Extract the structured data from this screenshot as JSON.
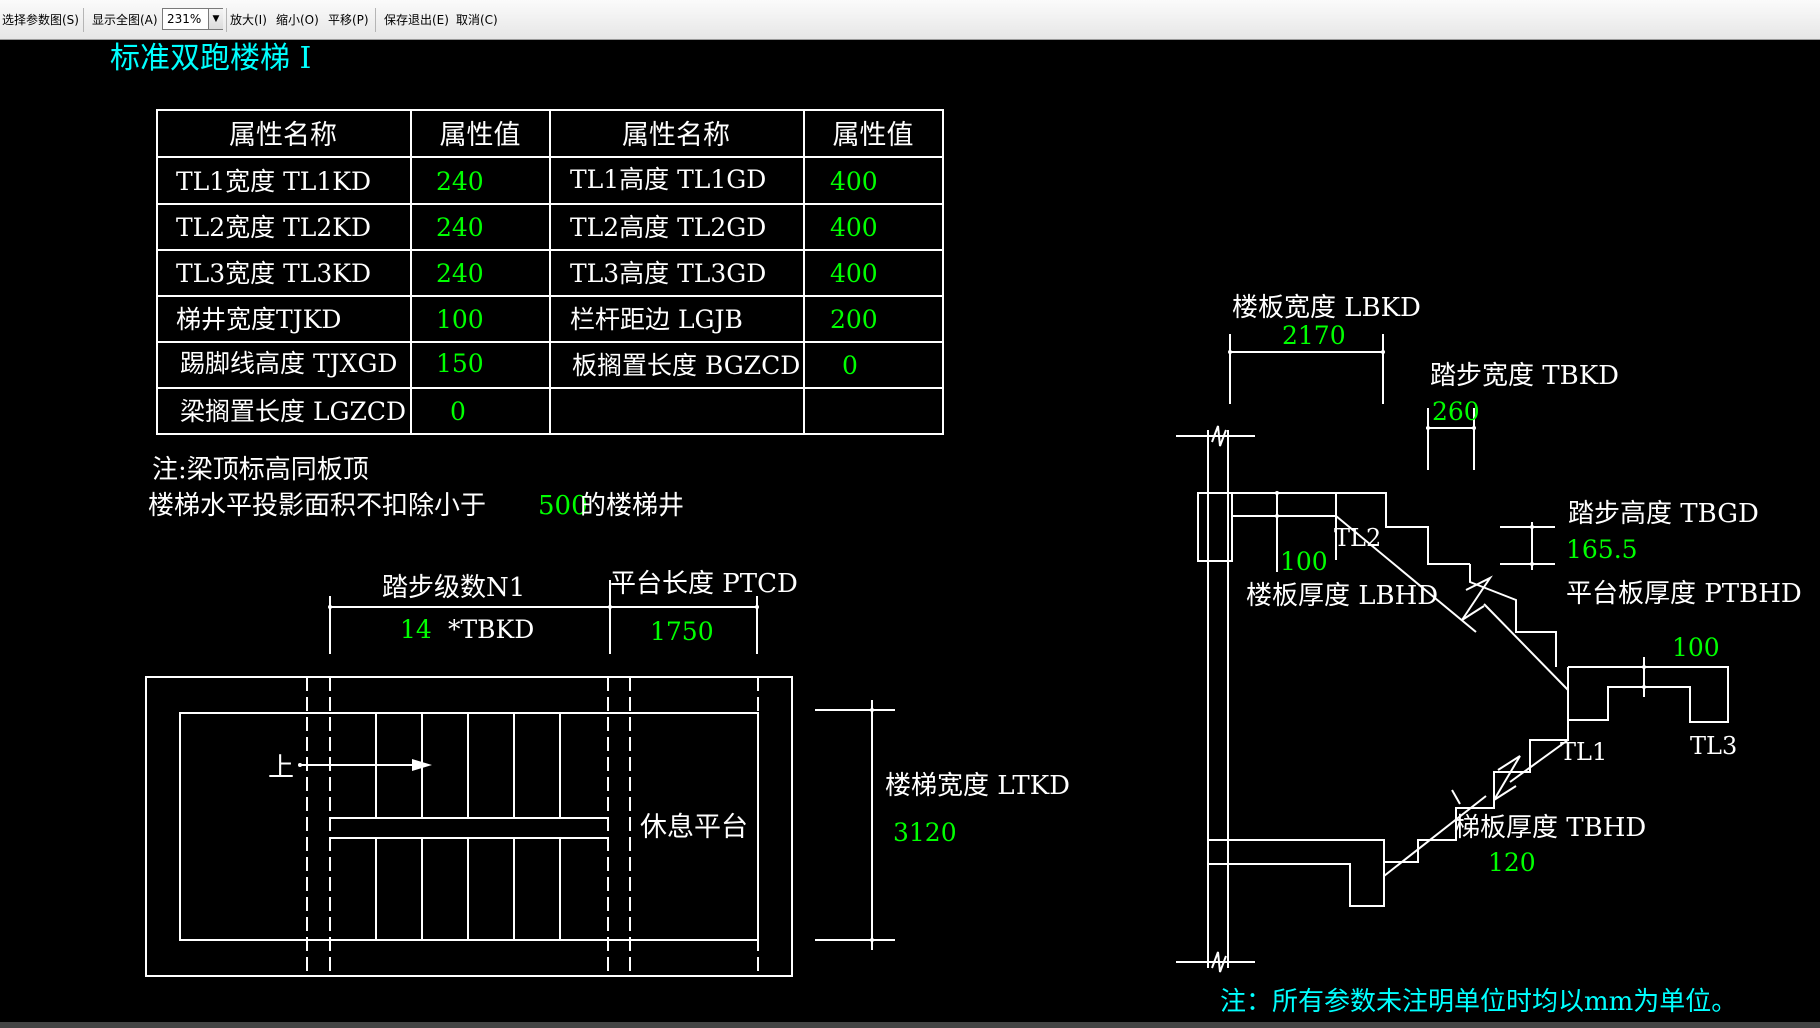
{
  "toolbar": {
    "select_params": "选择参数图(S)",
    "show_all": "显示全图(A)",
    "zoom_value": "231%",
    "zoom_in": "放大(I)",
    "zoom_out": "缩小(O)",
    "pan": "平移(P)",
    "save_exit": "保存退出(E)",
    "cancel": "取消(C)"
  },
  "title": "标准双跑楼梯 I",
  "table": {
    "headers": [
      "属性名称",
      "属性值",
      "属性名称",
      "属性值"
    ],
    "rows": [
      [
        "TL1宽度 TL1KD",
        "240",
        "TL1高度 TL1GD",
        "400"
      ],
      [
        "TL2宽度 TL2KD",
        "240",
        "TL2高度 TL2GD",
        "400"
      ],
      [
        "TL3宽度 TL3KD",
        "240",
        "TL3高度 TL3GD",
        "400"
      ],
      [
        "梯井宽度TJKD",
        "100",
        "栏杆距边 LGJB",
        "200"
      ],
      [
        "踢脚线高度 TJXGD",
        "150",
        "板搁置长度 BGZCD",
        "0"
      ],
      [
        "梁搁置长度 LGZCD",
        "0",
        "",
        ""
      ]
    ]
  },
  "notes": {
    "note1": "注:梁顶标高同板顶",
    "note2_prefix": "楼梯水平投影面积不扣除小于",
    "note2_value": "500",
    "note2_suffix": "的楼梯井"
  },
  "plan": {
    "steps_label": "踏步级数N1",
    "steps_value": "14",
    "steps_unit": "*TBKD",
    "platform_label": "平台长度 PTCD",
    "platform_value": "1750",
    "up_label": "上",
    "rest_label": "休息平台",
    "width_label": "楼梯宽度 LTKD",
    "width_value": "3120"
  },
  "section": {
    "lbkd_label": "楼板宽度 LBKD",
    "lbkd_value": "2170",
    "tbkd_label": "踏步宽度 TBKD",
    "tbkd_value": "260",
    "tbgd_label": "踏步高度 TBGD",
    "tbgd_value": "165.5",
    "lbhd_value": "100",
    "lbhd_label": "楼板厚度 LBHD",
    "ptbhd_label": "平台板厚度 PTBHD",
    "ptbhd_value": "100",
    "tbhd_label": "梯板厚度 TBHD",
    "tbhd_value": "120",
    "tl1": "TL1",
    "tl2": "TL2",
    "tl3": "TL3"
  },
  "footer_note": "注：所有参数未注明单位时均以mm为单位。",
  "colors": {
    "background": "#000000",
    "line": "#ffffff",
    "value": "#00ff00",
    "title": "#00ffff"
  }
}
